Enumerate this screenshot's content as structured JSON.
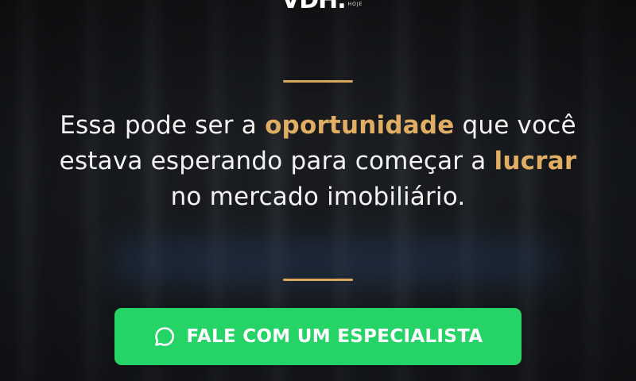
{
  "logo": {
    "text": "VDH.",
    "sub": "HOJE"
  },
  "headline": {
    "part1": "Essa pode ser a ",
    "highlight1": "oportunidade",
    "part2": " que você estava esperando para começar a ",
    "highlight2": "lucrar",
    "part3": " no mercado imobiliário."
  },
  "cta": {
    "label": "FALE COM UM ESPECIALISTA",
    "icon": "whatsapp-chat-icon"
  },
  "colors": {
    "accent": "#e0ad63",
    "cta": "#25d366",
    "text": "#f3f3f3"
  }
}
